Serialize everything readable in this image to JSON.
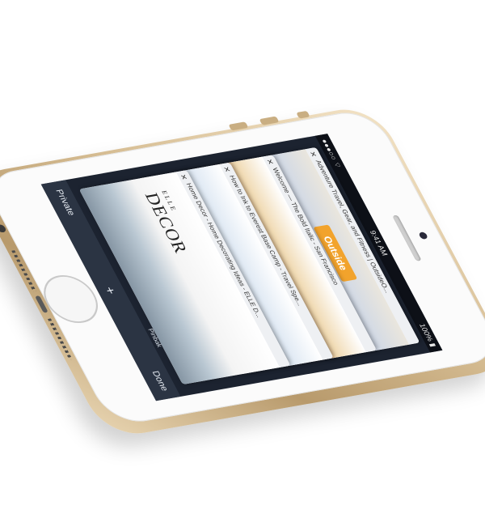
{
  "statusbar": {
    "carrier": "●●●○○ ⌔",
    "time": "9:41 AM",
    "battery": "100% ▮"
  },
  "tabs": [
    {
      "title": "Adventure Travel, Gear, and Fitness | OutsideO...",
      "logo": "Outside"
    },
    {
      "title": "Welcome — The Bold Italic - San Francisco"
    },
    {
      "title": "How to Ink to Everest Base Camp - Travel Spe..."
    },
    {
      "title": "Home Decor - Home Decorating Ideas - ELLE D...",
      "logo": "DECOR",
      "logo_prefix": "ELLE"
    }
  ],
  "toolbar": {
    "private_label": "Private",
    "plus_label": "+",
    "done_label": "Done",
    "pinned_label": "Pinbak"
  },
  "colors": {
    "gold_edge": "#d6bd93",
    "face": "#fbfbfb",
    "toolbar": "#2b3443"
  }
}
